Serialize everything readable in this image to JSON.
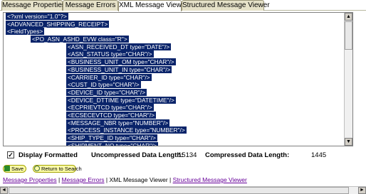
{
  "tabs": [
    {
      "label": "Message Properties",
      "active": false
    },
    {
      "label": "Message Errors",
      "active": false
    },
    {
      "label": "XML Message Viewer",
      "active": true
    },
    {
      "label": "Structured Message Viewer",
      "active": false
    }
  ],
  "xml_viewer": {
    "lines": [
      {
        "indent": 0,
        "text": "<?xml version=\"1.0\"?>"
      },
      {
        "indent": 0,
        "text": "<ADVANCED_SHIPPING_RECEIPT>"
      },
      {
        "indent": 1,
        "text": "<FieldTypes>"
      },
      {
        "indent": 2,
        "text": "<PO_ASN_ASHD_EVW class=\"R\">"
      },
      {
        "indent": 3,
        "text": "<ASN_RECEIVED_DT type=\"DATE\"/>"
      },
      {
        "indent": 3,
        "text": "<ASN_STATUS type=\"CHAR\"/>"
      },
      {
        "indent": 3,
        "text": "<BUSINESS_UNIT_OM type=\"CHAR\"/>"
      },
      {
        "indent": 3,
        "text": "<BUSINESS_UNIT_IN type=\"CHAR\"/>"
      },
      {
        "indent": 3,
        "text": "<CARRIER_ID type=\"CHAR\"/>"
      },
      {
        "indent": 3,
        "text": "<CUST_ID type=\"CHAR\"/>"
      },
      {
        "indent": 3,
        "text": "<DEVICE_ID type=\"CHAR\"/>"
      },
      {
        "indent": 3,
        "text": "<DEVICE_DTTIME type=\"DATETIME\"/>"
      },
      {
        "indent": 3,
        "text": "<ECPRIEVTCD type=\"CHAR\"/>"
      },
      {
        "indent": 3,
        "text": "<ECSECEVTCD type=\"CHAR\"/>"
      },
      {
        "indent": 3,
        "text": "<MESSAGE_NBR type=\"NUMBER\"/>"
      },
      {
        "indent": 3,
        "text": "<PROCESS_INSTANCE type=\"NUMBER\"/>"
      },
      {
        "indent": 3,
        "text": "<SHIP_TYPE_ID type=\"CHAR\"/>"
      },
      {
        "indent": 3,
        "text": "<SHIPMENT_NO type=\"CHAR\"/>"
      },
      {
        "indent": 3,
        "text": "<SHIPTO_SETID type=\"CHAR\"/>"
      }
    ],
    "scroll_up_glyph": "▲",
    "scroll_down_glyph": "▼"
  },
  "status": {
    "display_formatted_label": "Display Formatted",
    "display_formatted_checked": true,
    "check_glyph": "✓",
    "uncompressed_label": "Uncompressed Data Length:",
    "uncompressed_value": "15134",
    "compressed_label": "Compressed Data Length:",
    "compressed_value": "1445"
  },
  "buttons": {
    "save_label": "Save",
    "return_label": "Return to Search"
  },
  "links": {
    "message_properties": "Message Properties",
    "message_errors": "Message Errors",
    "xml_message_viewer": "XML Message Viewer",
    "structured_message_viewer": "Structured Message Viewer",
    "separator": " | "
  },
  "hscroll": {
    "left_glyph": "◄",
    "right_glyph": "►"
  },
  "colors": {
    "selection_bg": "#0a246a",
    "tab_bg": "#e6e2c9",
    "button_bg": "#fcfca8",
    "visited_link": "#660099"
  }
}
